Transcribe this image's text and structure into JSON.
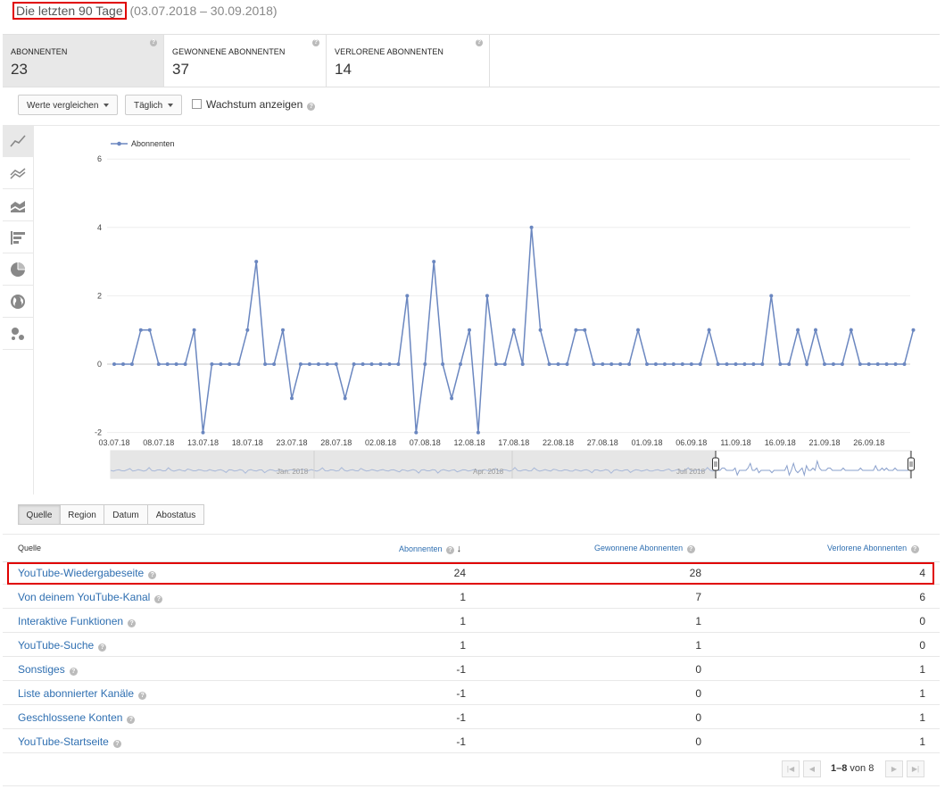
{
  "header": {
    "range_label": "Die letzten 90 Tage",
    "range_dates": "(03.07.2018 – 30.09.2018)"
  },
  "metrics": [
    {
      "label": "ABONNENTEN",
      "value": "23",
      "active": true
    },
    {
      "label": "GEWONNENE ABONNENTEN",
      "value": "37",
      "active": false
    },
    {
      "label": "VERLORENE ABONNENTEN",
      "value": "14",
      "active": false
    }
  ],
  "controls": {
    "compare_label": "Werte vergleichen",
    "interval_label": "Täglich",
    "growth_label": "Wachstum anzeigen"
  },
  "chart_data": {
    "type": "line",
    "legend": [
      "Abonnenten"
    ],
    "series": [
      {
        "name": "Abonnenten",
        "values": [
          0,
          0,
          0,
          1,
          1,
          0,
          0,
          0,
          0,
          1,
          -2,
          0,
          0,
          0,
          0,
          1,
          3,
          0,
          0,
          1,
          -1,
          0,
          0,
          0,
          0,
          0,
          -1,
          0,
          0,
          0,
          0,
          0,
          0,
          2,
          -2,
          0,
          3,
          0,
          -1,
          0,
          1,
          -2,
          2,
          0,
          0,
          1,
          0,
          4,
          1,
          0,
          0,
          0,
          1,
          1,
          0,
          0,
          0,
          0,
          0,
          1,
          0,
          0,
          0,
          0,
          0,
          0,
          0,
          1,
          0,
          0,
          0,
          0,
          0,
          0,
          2,
          0,
          0,
          1,
          0,
          1,
          0,
          0,
          0,
          1,
          0,
          0,
          0,
          0,
          0,
          0,
          1
        ]
      }
    ],
    "start_date": "03.07.18",
    "x_tick_labels": [
      "03.07.18",
      "08.07.18",
      "13.07.18",
      "18.07.18",
      "23.07.18",
      "28.07.18",
      "02.08.18",
      "07.08.18",
      "12.08.18",
      "17.08.18",
      "22.08.18",
      "27.08.18",
      "01.09.18",
      "06.09.18",
      "11.09.18",
      "16.09.18",
      "21.09.18",
      "26.09.18"
    ],
    "y_ticks": [
      6,
      4,
      2,
      0,
      -2
    ],
    "ylim": [
      -2,
      6
    ],
    "navigator_labels": [
      "Jan. 2018",
      "Apr. 2018",
      "Juli 2018"
    ],
    "colors": {
      "line": "#6b87c0"
    }
  },
  "tabs": [
    "Quelle",
    "Region",
    "Datum",
    "Abostatus"
  ],
  "table": {
    "headers": {
      "source": "Quelle",
      "subs": "Abonnenten",
      "gained": "Gewonnene Abonnenten",
      "lost": "Verlorene Abonnenten"
    },
    "rows": [
      {
        "source": "YouTube-Wiedergabeseite",
        "subs": "24",
        "gained": "28",
        "lost": "4"
      },
      {
        "source": "Von deinem YouTube-Kanal",
        "subs": "1",
        "gained": "7",
        "lost": "6"
      },
      {
        "source": "Interaktive Funktionen",
        "subs": "1",
        "gained": "1",
        "lost": "0"
      },
      {
        "source": "YouTube-Suche",
        "subs": "1",
        "gained": "1",
        "lost": "0"
      },
      {
        "source": "Sonstiges",
        "subs": "-1",
        "gained": "0",
        "lost": "1"
      },
      {
        "source": "Liste abonnierter Kanäle",
        "subs": "-1",
        "gained": "0",
        "lost": "1"
      },
      {
        "source": "Geschlossene Konten",
        "subs": "-1",
        "gained": "0",
        "lost": "1"
      },
      {
        "source": "YouTube-Startseite",
        "subs": "-1",
        "gained": "0",
        "lost": "1"
      }
    ]
  },
  "pager": {
    "range": "1–8",
    "of": "von 8"
  },
  "colors": {
    "link": "#2f6fb1",
    "highlight": "#e00000"
  }
}
